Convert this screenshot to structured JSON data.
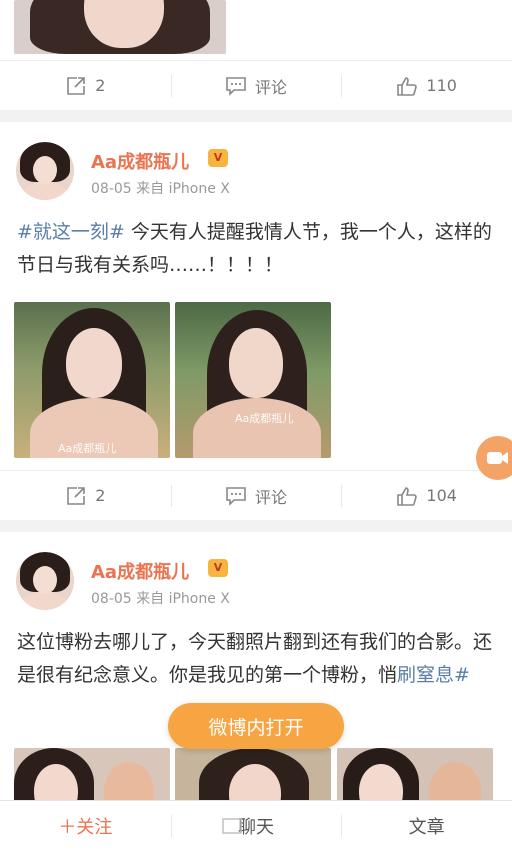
{
  "post1": {
    "actions": {
      "repost": "2",
      "comment": "评论",
      "like": "110"
    }
  },
  "post2": {
    "username": "Aa成都瓶儿",
    "meta": "08-05 来自 iPhone X",
    "hashtag": "#就这一刻#",
    "text": " 今天有人提醒我情人节，我一个人，这样的节日与我有关系吗……！！！！",
    "watermark": "Aa成都瓶儿",
    "actions": {
      "repost": "2",
      "comment": "评论",
      "like": "104"
    }
  },
  "post3": {
    "username": "Aa成都瓶儿",
    "meta": "08-05 来自 iPhone X",
    "text": "这位博粉去哪儿了，今天翻照片翻到还有我们的合影。还是很有纪念意义。你是我见的第一个博粉，悄",
    "hashtag": "刷窒息#"
  },
  "open_in_app": "微博内打开",
  "bottom_bar": {
    "follow": "＋关注",
    "chat": "聊天",
    "article": "文章"
  },
  "colors": {
    "brand": "#eb7350",
    "link": "#5b7ea8",
    "open_button": "#f7a443"
  }
}
